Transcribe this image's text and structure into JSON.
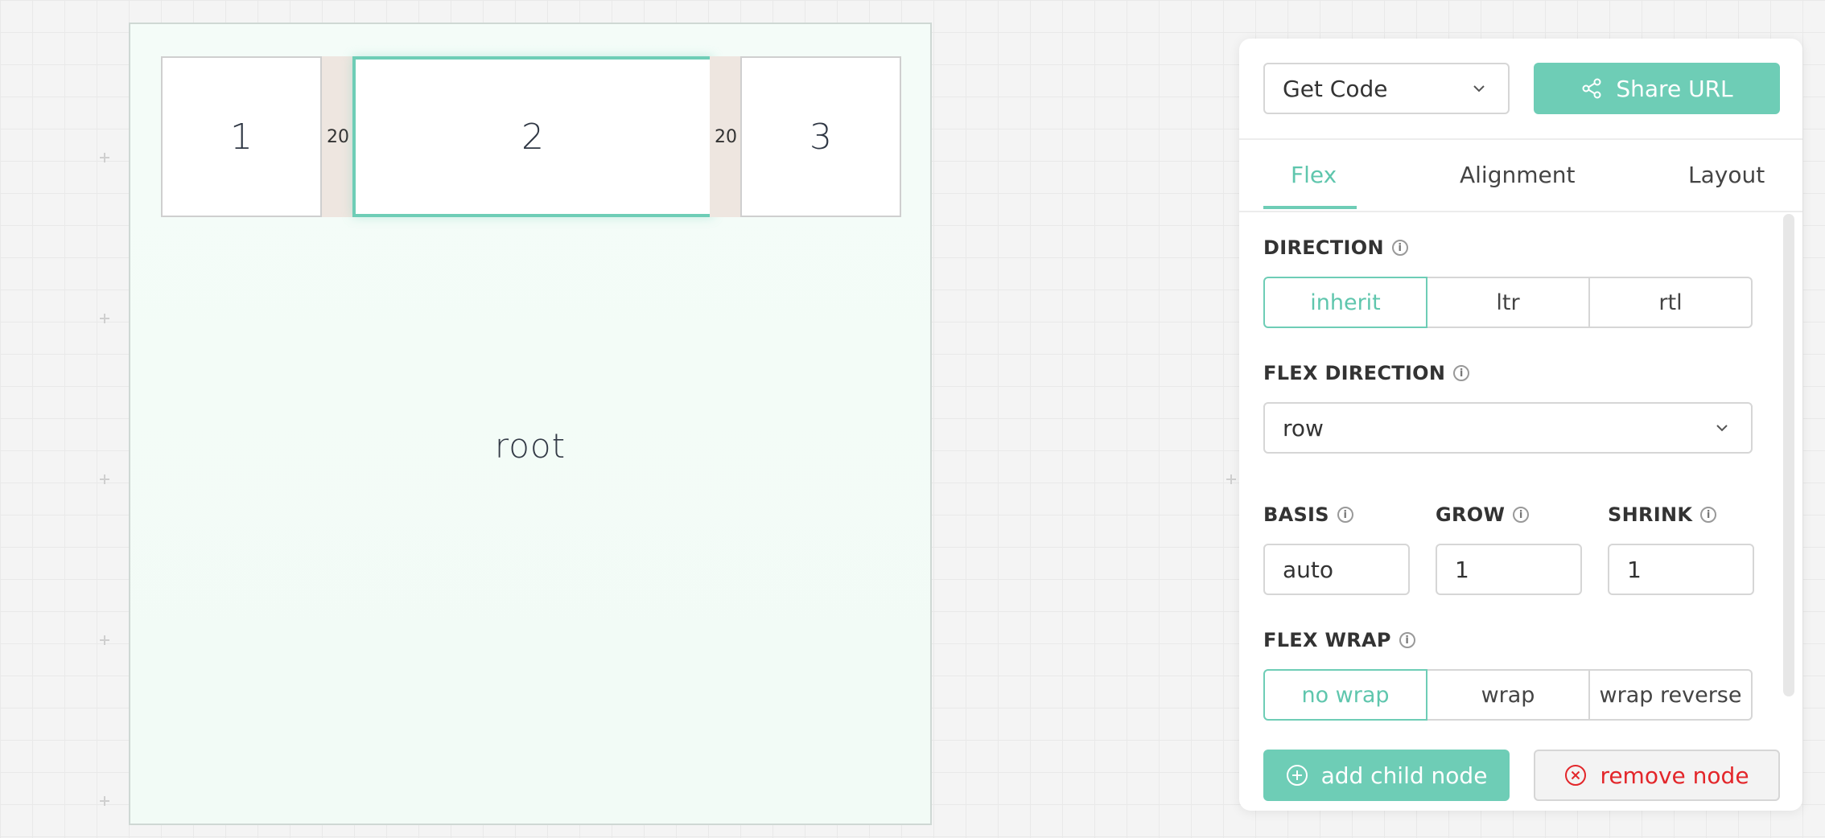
{
  "canvas": {
    "root_label": "root",
    "children": [
      {
        "label": "1",
        "selected": false
      },
      {
        "label": "2",
        "selected": true
      },
      {
        "label": "3",
        "selected": false
      }
    ],
    "gaps": [
      "20",
      "20"
    ]
  },
  "panel": {
    "get_code_label": "Get Code",
    "share_label": "Share URL",
    "tabs": [
      {
        "label": "Flex",
        "active": true
      },
      {
        "label": "Alignment",
        "active": false
      },
      {
        "label": "Layout",
        "active": false
      }
    ],
    "direction": {
      "label": "DIRECTION",
      "options": [
        "inherit",
        "ltr",
        "rtl"
      ],
      "selected": "inherit"
    },
    "flex_direction": {
      "label": "FLEX DIRECTION",
      "value": "row"
    },
    "basis": {
      "label": "BASIS",
      "value": "auto"
    },
    "grow": {
      "label": "GROW",
      "value": "1"
    },
    "shrink": {
      "label": "SHRINK",
      "value": "1"
    },
    "flex_wrap": {
      "label": "FLEX WRAP",
      "options": [
        "no wrap",
        "wrap",
        "wrap reverse"
      ],
      "selected": "no wrap"
    },
    "add_child_label": "add child node",
    "remove_label": "remove node"
  },
  "colors": {
    "accent": "#6ecdb6",
    "danger": "#e3262a",
    "root_bg": "#f2fbf6",
    "gap_bg": "#eee6e0"
  },
  "icons": {
    "dropdown": "chevron-down-icon",
    "share": "share-icon",
    "info": "info-icon",
    "add": "plus-circle-icon",
    "remove": "x-circle-icon"
  }
}
